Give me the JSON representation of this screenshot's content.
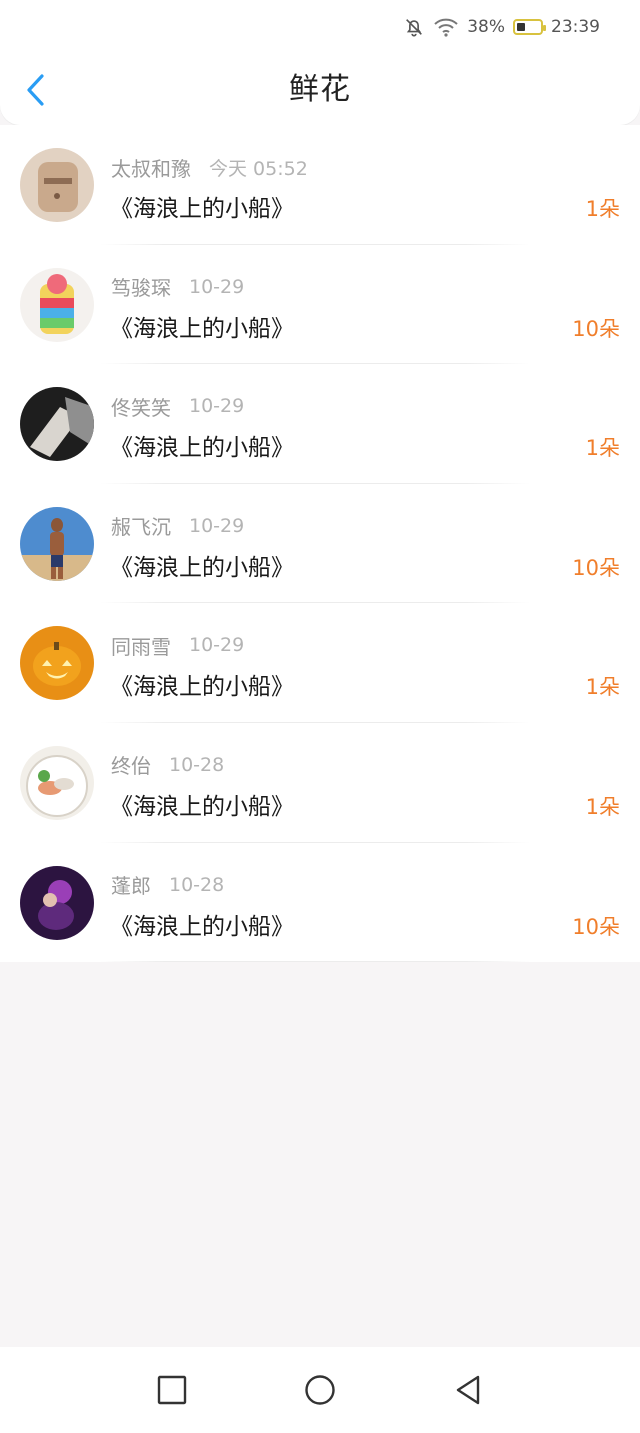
{
  "status_bar": {
    "battery_percent": "38%",
    "battery_level": 0.38,
    "time": "23:39",
    "icons": [
      "bell-muted-icon",
      "wifi-icon",
      "battery-icon"
    ]
  },
  "header": {
    "title": "鲜花",
    "back_icon": "chevron-left-icon",
    "accent_color": "#2a9df4"
  },
  "colors": {
    "count_color": "#f07e2b",
    "name_color": "#9a9a9a"
  },
  "items": [
    {
      "name": "太叔和豫",
      "time": "今天 05:52",
      "work": "《海浪上的小船》",
      "count": "1朵"
    },
    {
      "name": "笃骏琛",
      "time": "10-29",
      "work": "《海浪上的小船》",
      "count": "10朵"
    },
    {
      "name": "佟笑笑",
      "time": "10-29",
      "work": "《海浪上的小船》",
      "count": "1朵"
    },
    {
      "name": "赧飞沉",
      "time": "10-29",
      "work": "《海浪上的小船》",
      "count": "10朵"
    },
    {
      "name": "同雨雪",
      "time": "10-29",
      "work": "《海浪上的小船》",
      "count": "1朵"
    },
    {
      "name": "终佁",
      "time": "10-28",
      "work": "《海浪上的小船》",
      "count": "1朵"
    },
    {
      "name": "蓬郎",
      "time": "10-28",
      "work": "《海浪上的小船》",
      "count": "10朵"
    }
  ],
  "nav": {
    "icons": [
      "square-recents-icon",
      "circle-home-icon",
      "triangle-back-icon"
    ]
  }
}
